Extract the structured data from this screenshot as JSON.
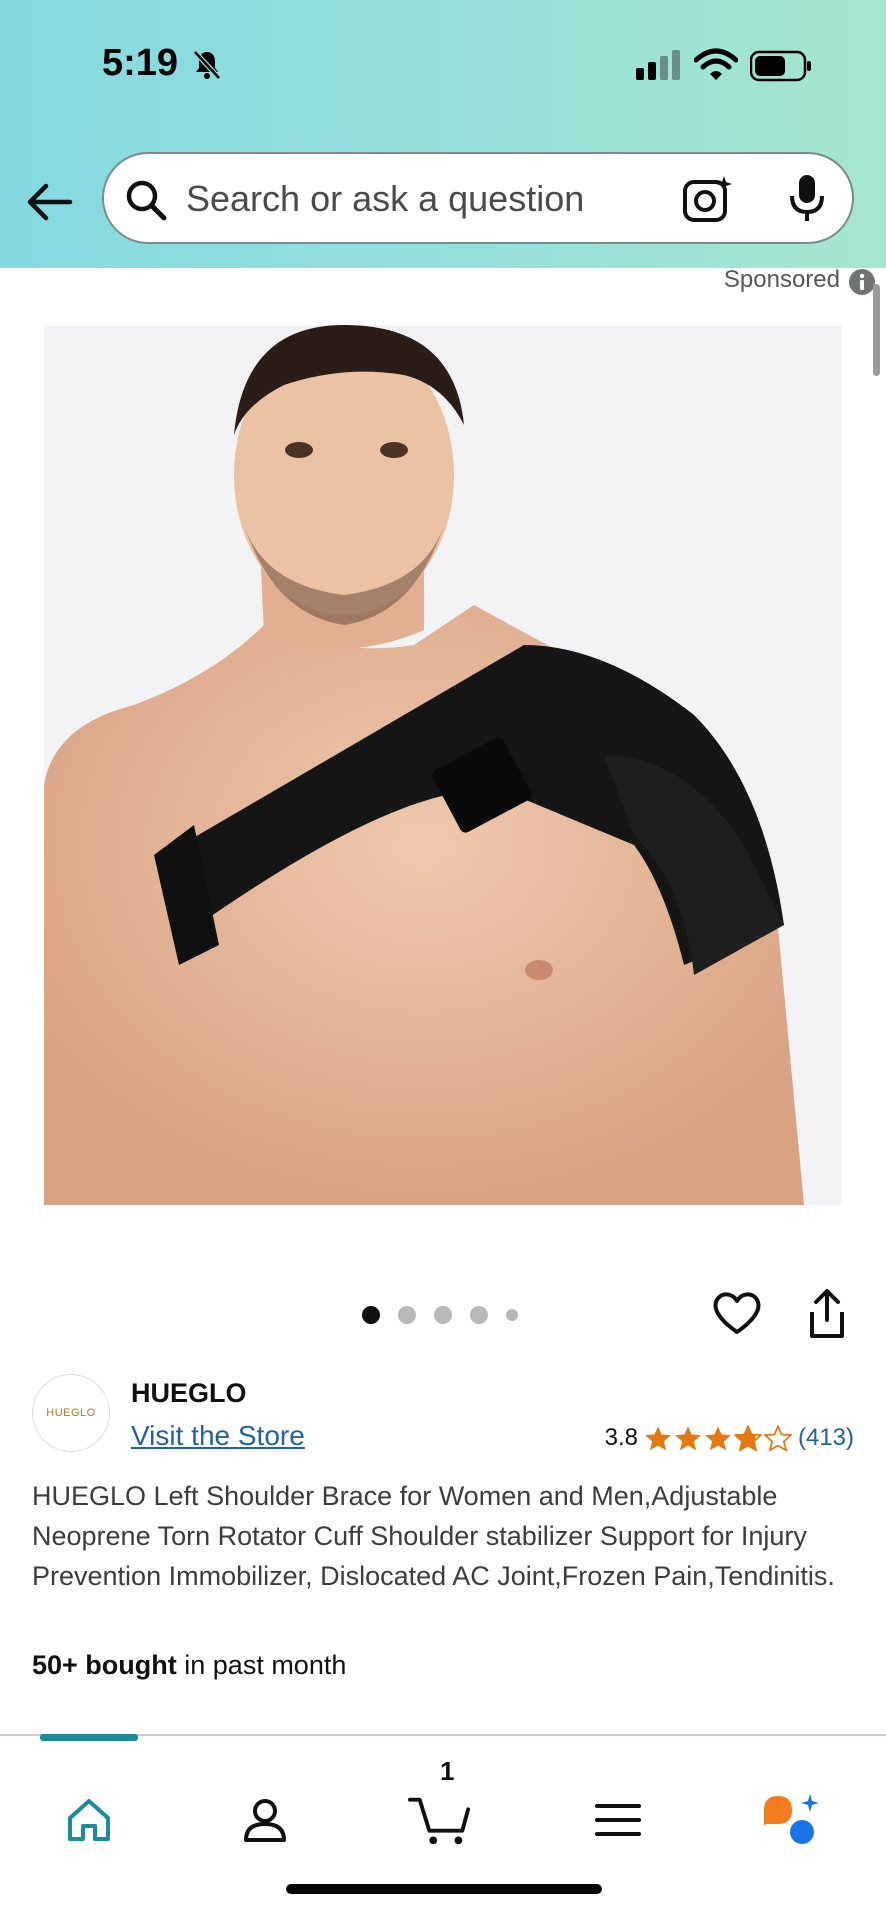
{
  "status_bar": {
    "time": "5:19"
  },
  "search": {
    "placeholder": "Search or ask a question"
  },
  "sponsored_label": "Sponsored",
  "carousel": {
    "total": 5,
    "active_index": 0
  },
  "brand": {
    "logo_text": "HUEGLO",
    "name": "HUEGLO",
    "visit_store": "Visit the Store"
  },
  "rating": {
    "value": "3.8",
    "count": "(413)",
    "stars_filled": 3.8,
    "stars_total": 5
  },
  "product": {
    "title": "HUEGLO Left Shoulder Brace for Women and Men,Adjustable Neoprene Torn Rotator Cuff Shoulder stabilizer Support for Injury Prevention Immobilizer, Dislocated AC Joint,Frozen Pain,Tendinitis.",
    "bought_bold": "50+ bought",
    "bought_rest": " in past month"
  },
  "bottom_nav": {
    "cart_count": "1",
    "items": [
      "home-icon",
      "account-icon",
      "cart-icon",
      "menu-icon",
      "rufus-icon"
    ],
    "active": "home-icon"
  },
  "colors": {
    "header_gradient_start": "#84d9e1",
    "header_gradient_end": "#a6e6cf",
    "link": "#2162a1",
    "star": "#e47911",
    "nav_active": "#1a8c9a",
    "rufus_orange": "#f57c1f",
    "rufus_blue": "#1a73e8"
  }
}
